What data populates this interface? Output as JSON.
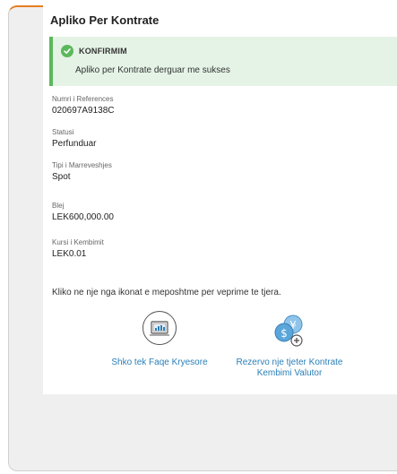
{
  "page": {
    "title": "Apliko Per Kontrate"
  },
  "alert": {
    "heading": "KONFIRMIM",
    "message": "Apliko per Kontrate derguar me sukses",
    "icon": "check-circle-icon",
    "color": "#5cb85c"
  },
  "fields": [
    {
      "label": "Numri i References",
      "value": "020697A9138C"
    },
    {
      "label": "Statusi",
      "value": "Perfunduar"
    },
    {
      "label": "Tipi i Marreveshjes",
      "value": "Spot"
    },
    {
      "label": "Blej",
      "value": "LEK600,000.00"
    },
    {
      "label": "Kursi i Kembimit",
      "value": "LEK0.01"
    }
  ],
  "hint": "Kliko ne nje nga ikonat e meposhtme per veprime te tjera.",
  "actions": {
    "home": {
      "label": "Shko tek Faqe Kryesore",
      "icon": "dashboard-icon"
    },
    "fx": {
      "label_line1": "Rezervo nje tjeter Kontrate",
      "label_line2": "Kembimi Valutor",
      "icon": "currency-exchange-icon"
    }
  },
  "colors": {
    "accent_border": "#e67e22",
    "link": "#2a7fb8",
    "success": "#5cb85c"
  }
}
